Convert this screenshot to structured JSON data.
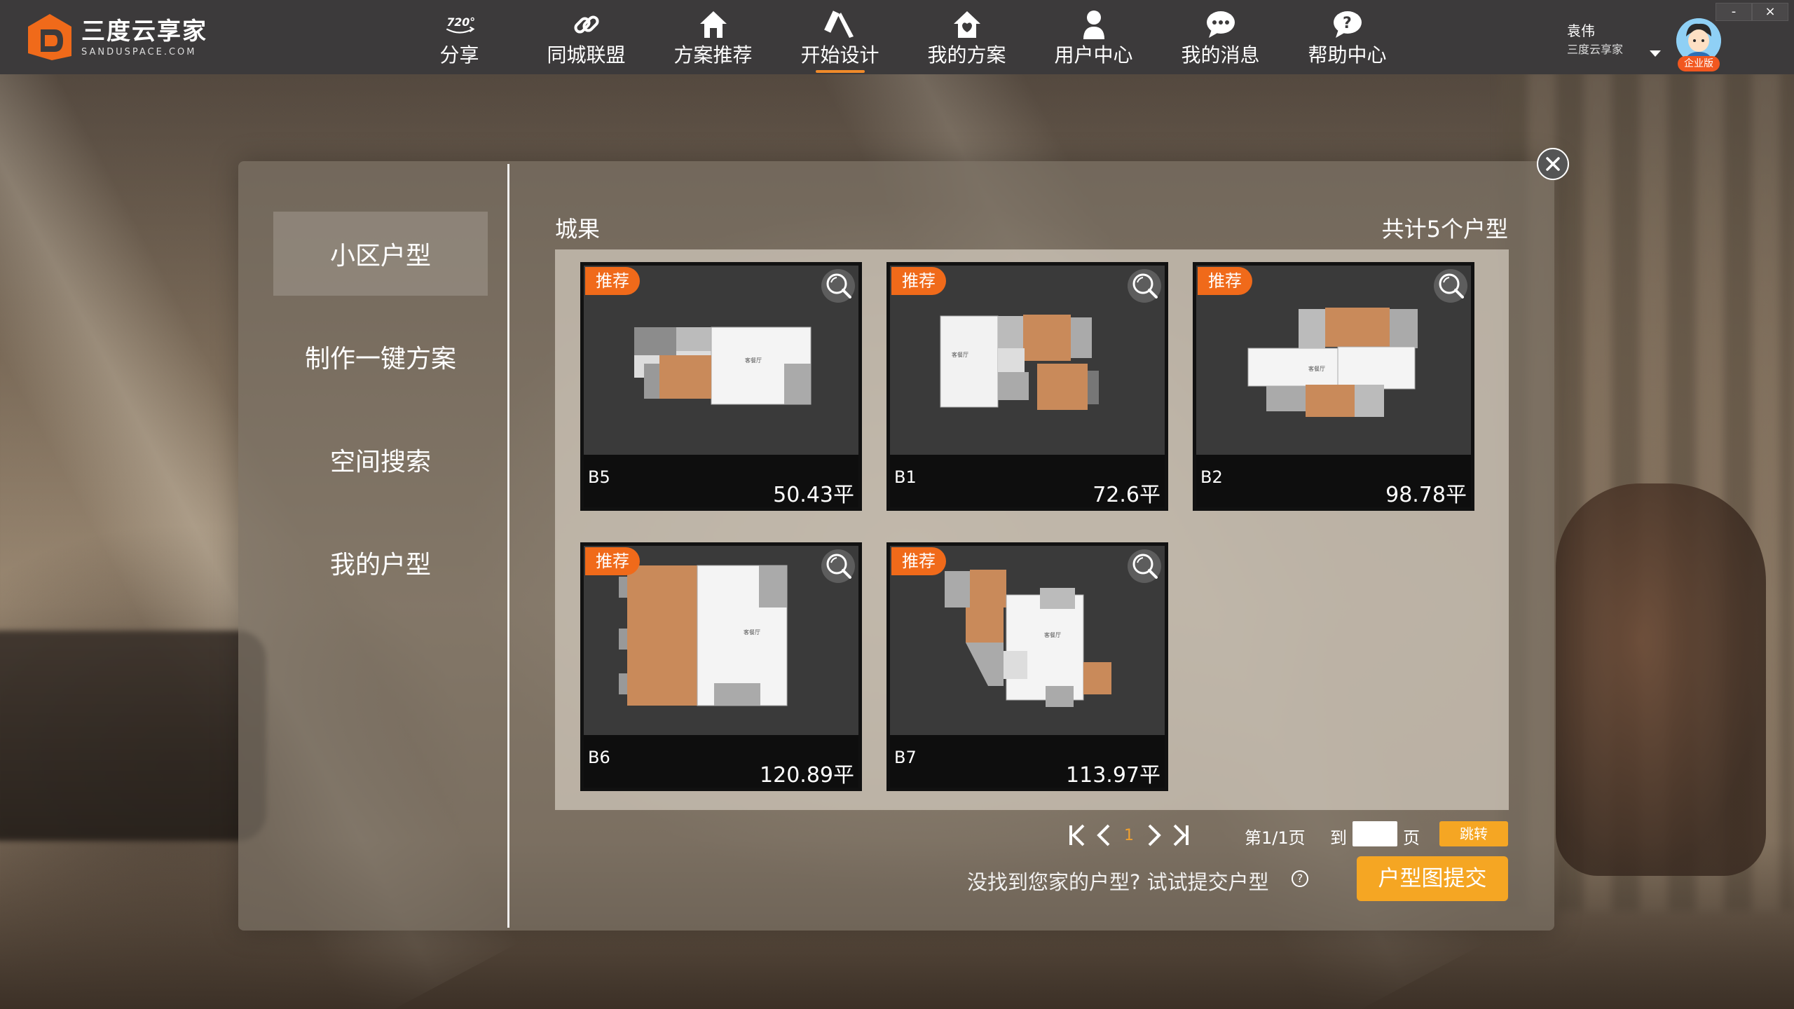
{
  "app": {
    "logo_title": "三度云享家",
    "logo_sub": "SANDUSPACE.COM",
    "brand_color": "#f06a1a"
  },
  "nav": {
    "items": [
      {
        "label": "分享",
        "icon": "720-icon"
      },
      {
        "label": "同城联盟",
        "icon": "link-icon"
      },
      {
        "label": "方案推荐",
        "icon": "house-icon"
      },
      {
        "label": "开始设计",
        "icon": "design-tools-icon",
        "active": true
      },
      {
        "label": "我的方案",
        "icon": "home-plan-icon"
      },
      {
        "label": "用户中心",
        "icon": "user-icon"
      },
      {
        "label": "我的消息",
        "icon": "message-icon"
      },
      {
        "label": "帮助中心",
        "icon": "help-icon"
      }
    ]
  },
  "user": {
    "name": "袁伟",
    "company": "三度云享家",
    "badge": "企业版"
  },
  "window": {
    "minimize": "-",
    "close": "×"
  },
  "sidebar": {
    "items": [
      {
        "label": "小区户型",
        "active": true
      },
      {
        "label": "制作一键方案"
      },
      {
        "label": "空间搜索"
      },
      {
        "label": "我的户型"
      }
    ]
  },
  "content": {
    "community": "城果",
    "total": "共计5个户型",
    "tag_label": "推荐",
    "cards": [
      {
        "name": "B5",
        "area": "50.43平"
      },
      {
        "name": "B1",
        "area": "72.6平"
      },
      {
        "name": "B2",
        "area": "98.78平"
      },
      {
        "name": "B6",
        "area": "120.89平"
      },
      {
        "name": "B7",
        "area": "113.97平"
      }
    ]
  },
  "pager": {
    "current": "1",
    "info": "第1/1页",
    "goto_label": "到",
    "page_unit": "页",
    "goto_button": "跳转",
    "input_value": ""
  },
  "footer": {
    "help_text": "没找到您家的户型?  试试提交户型",
    "help_icon": "?",
    "submit_button": "户型图提交"
  }
}
